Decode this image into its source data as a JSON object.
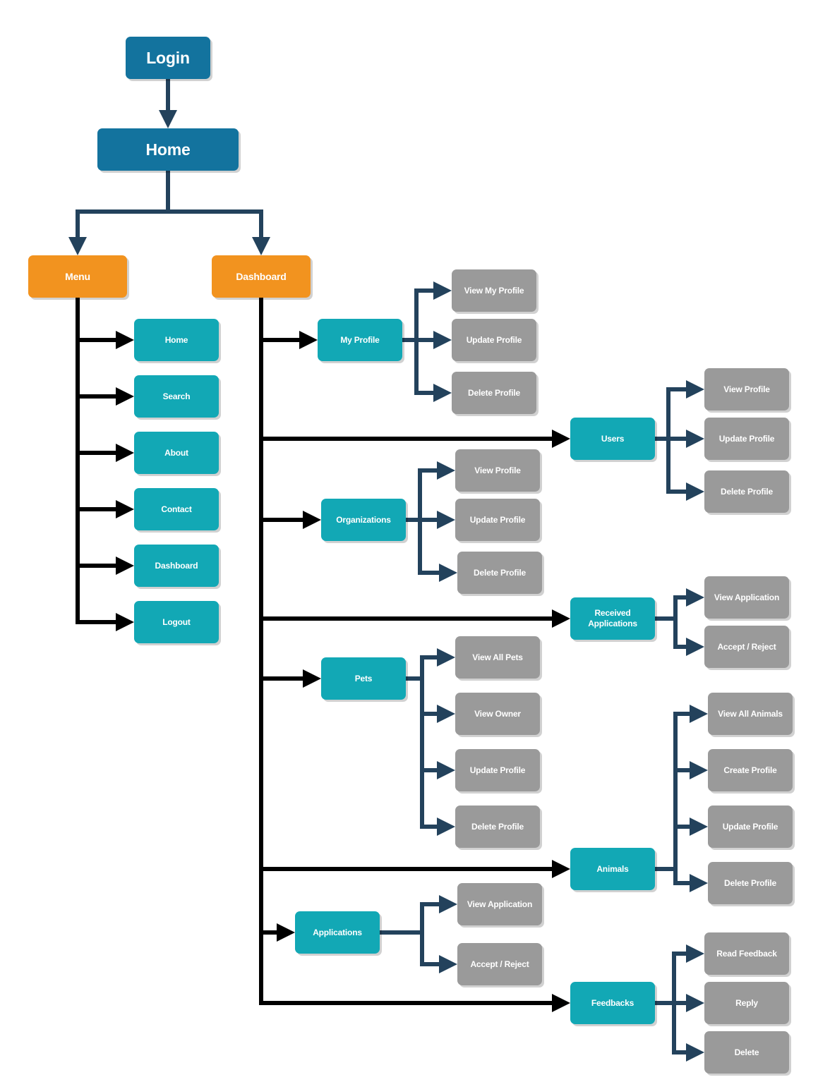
{
  "colors": {
    "primary": "#13739e",
    "orange": "#f2931f",
    "teal": "#12a8b5",
    "gray": "#9a9a9a",
    "connector": "#23425c",
    "trunk": "#000000"
  },
  "nodes": {
    "login": {
      "label": "Login",
      "kind": "primary"
    },
    "home": {
      "label": "Home",
      "kind": "primary"
    },
    "menu": {
      "label": "Menu",
      "kind": "orange"
    },
    "dashboard": {
      "label": "Dashboard",
      "kind": "orange"
    },
    "m_home": {
      "label": "Home",
      "kind": "teal"
    },
    "m_search": {
      "label": "Search",
      "kind": "teal"
    },
    "m_about": {
      "label": "About",
      "kind": "teal"
    },
    "m_contact": {
      "label": "Contact",
      "kind": "teal"
    },
    "m_dashboard": {
      "label": "Dashboard",
      "kind": "teal"
    },
    "m_logout": {
      "label": "Logout",
      "kind": "teal"
    },
    "myprofile": {
      "label": "My Profile",
      "kind": "teal"
    },
    "mp_view": {
      "label": "View My Profile",
      "kind": "gray"
    },
    "mp_update": {
      "label": "Update Profile",
      "kind": "gray"
    },
    "mp_delete": {
      "label": "Delete Profile",
      "kind": "gray"
    },
    "users": {
      "label": "Users",
      "kind": "teal"
    },
    "u_view": {
      "label": "View Profile",
      "kind": "gray"
    },
    "u_update": {
      "label": "Update Profile",
      "kind": "gray"
    },
    "u_delete": {
      "label": "Delete Profile",
      "kind": "gray"
    },
    "orgs": {
      "label": "Organizations",
      "kind": "teal"
    },
    "o_view": {
      "label": "View Profile",
      "kind": "gray"
    },
    "o_update": {
      "label": "Update Profile",
      "kind": "gray"
    },
    "o_delete": {
      "label": "Delete Profile",
      "kind": "gray"
    },
    "recv": {
      "label": "Received\nApplications",
      "kind": "teal"
    },
    "r_view": {
      "label": "View Application",
      "kind": "gray"
    },
    "r_accept": {
      "label": "Accept / Reject",
      "kind": "gray"
    },
    "pets": {
      "label": "Pets",
      "kind": "teal"
    },
    "p_viewall": {
      "label": "View All Pets",
      "kind": "gray"
    },
    "p_owner": {
      "label": "View Owner",
      "kind": "gray"
    },
    "p_update": {
      "label": "Update Profile",
      "kind": "gray"
    },
    "p_delete": {
      "label": "Delete Profile",
      "kind": "gray"
    },
    "animals": {
      "label": "Animals",
      "kind": "teal"
    },
    "a_viewall": {
      "label": "View All Animals",
      "kind": "gray"
    },
    "a_create": {
      "label": "Create Profile",
      "kind": "gray"
    },
    "a_update": {
      "label": "Update Profile",
      "kind": "gray"
    },
    "a_delete": {
      "label": "Delete Profile",
      "kind": "gray"
    },
    "apps": {
      "label": "Applications",
      "kind": "teal"
    },
    "ap_view": {
      "label": "View Application",
      "kind": "gray"
    },
    "ap_accept": {
      "label": "Accept / Reject",
      "kind": "gray"
    },
    "feedbacks": {
      "label": "Feedbacks",
      "kind": "teal"
    },
    "f_read": {
      "label": "Read Feedback",
      "kind": "gray"
    },
    "f_reply": {
      "label": "Reply",
      "kind": "gray"
    },
    "f_delete": {
      "label": "Delete",
      "kind": "gray"
    }
  },
  "edges": {
    "login": [
      "home"
    ],
    "home": [
      "menu",
      "dashboard"
    ],
    "menu": [
      "m_home",
      "m_search",
      "m_about",
      "m_contact",
      "m_dashboard",
      "m_logout"
    ],
    "dashboard": [
      "myprofile",
      "users",
      "orgs",
      "recv",
      "pets",
      "animals",
      "apps",
      "feedbacks"
    ],
    "myprofile": [
      "mp_view",
      "mp_update",
      "mp_delete"
    ],
    "users": [
      "u_view",
      "u_update",
      "u_delete"
    ],
    "orgs": [
      "o_view",
      "o_update",
      "o_delete"
    ],
    "recv": [
      "r_view",
      "r_accept"
    ],
    "pets": [
      "p_viewall",
      "p_owner",
      "p_update",
      "p_delete"
    ],
    "animals": [
      "a_viewall",
      "a_create",
      "a_update",
      "a_delete"
    ],
    "apps": [
      "ap_view",
      "ap_accept"
    ],
    "feedbacks": [
      "f_read",
      "f_reply",
      "f_delete"
    ]
  }
}
